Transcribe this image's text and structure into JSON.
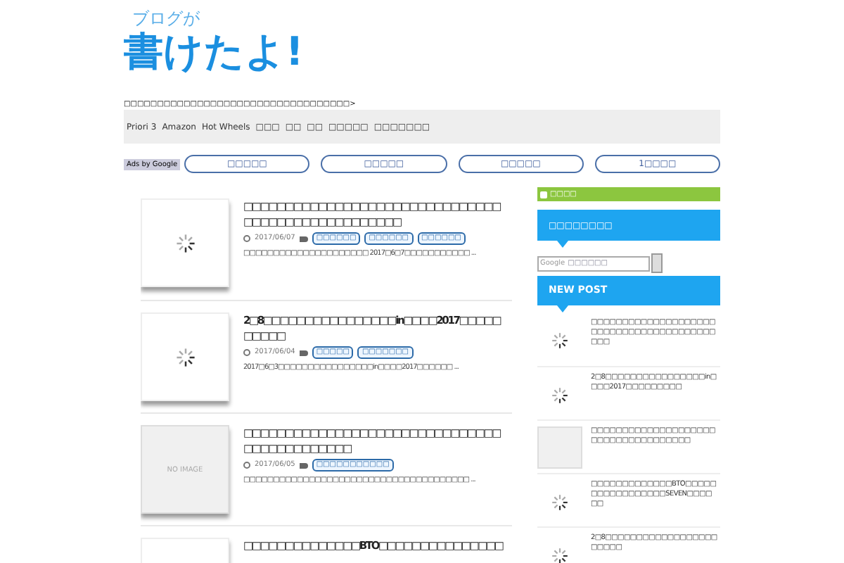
{
  "logo": {
    "small": "ブログが",
    "large": "書けたよ!"
  },
  "tagline": "□□□□□□□□□□□□□□□□□□□□□□□□□□□□□□□□□□>",
  "nav": [
    "Priori 3",
    "Amazon",
    "Hot Wheels",
    "□□□",
    "□□",
    "□□",
    "□□□□□",
    "□□□□□□□"
  ],
  "ads_label": "Ads by Google",
  "ad_links": [
    "□□□□□",
    "□□□□□",
    "□□□□□",
    "1□□□□"
  ],
  "posts": [
    {
      "kind": "spinner",
      "title": "□□□□□□□□□□□□□□□□□□□□□□□□□□□□□□□□□□□□□□□□□□□□□□□□□□",
      "date": "2017/06/07",
      "tags": [
        "□□□□□□",
        "□□□□□□",
        "□□□□□□"
      ],
      "excerpt": "□□□□□□□□□□□□□□□□□□□□□ 2017□6□7□□□□□□□□□□□ ..."
    },
    {
      "kind": "spinner",
      "title": "2□8□□□□□□□□□□□□□□□□in□□□□2017□□□□□□□□□□",
      "date": "2017/06/04",
      "tags": [
        "□□□□□",
        "□□□□□□□"
      ],
      "excerpt": "2017□6□3□□□□□□□□□□□□□□□□in□□□□2017□□□□□□ ..."
    },
    {
      "kind": "noimage",
      "thumb_text": "NO IMAGE",
      "title": "□□□□□□□□□□□□□□□□□□□□□□□□□□□□□□□□□□□□□□□□□□□□",
      "date": "2017/06/05",
      "tags": [
        "□□□□□□□□□□□"
      ],
      "excerpt": "□□□□□□□□□□□□□□□□□□□□□□□□□□□□□□□□□□□□□□ ..."
    },
    {
      "kind": "blank",
      "title": "□□□□□□□□□□□□□□BTO□□□□□□□□□□□□□□□"
    }
  ],
  "sidebar": {
    "rss_label": "□□□□",
    "search_heading": "□□□□□□□□",
    "search": {
      "brand": "Google",
      "placeholder": "□□□□□□"
    },
    "new_post_heading": "NEW POST",
    "new_posts": [
      {
        "kind": "spinner",
        "title": "□□□□□□□□□□□□□□□□□□□□□□□□□□□□□□□□□□□□□□□□□□□"
      },
      {
        "kind": "spinner",
        "title": "2□8□□□□□□□□□□□□□□□□in□□□□2017□□□□□□□□□"
      },
      {
        "kind": "noimage",
        "title": "□□□□□□□□□□□□□□□□□□□□□□□□□□□□□□□□□□□□"
      },
      {
        "kind": "spinner",
        "title": "□□□□□□□□□□□□□BTO□□□□□□□□□□□□□□□□□SEVEN□□□□□□"
      },
      {
        "kind": "spinner",
        "title": "2□8□□□□□□□□□□□□□□□□□□□□□□□"
      }
    ]
  }
}
